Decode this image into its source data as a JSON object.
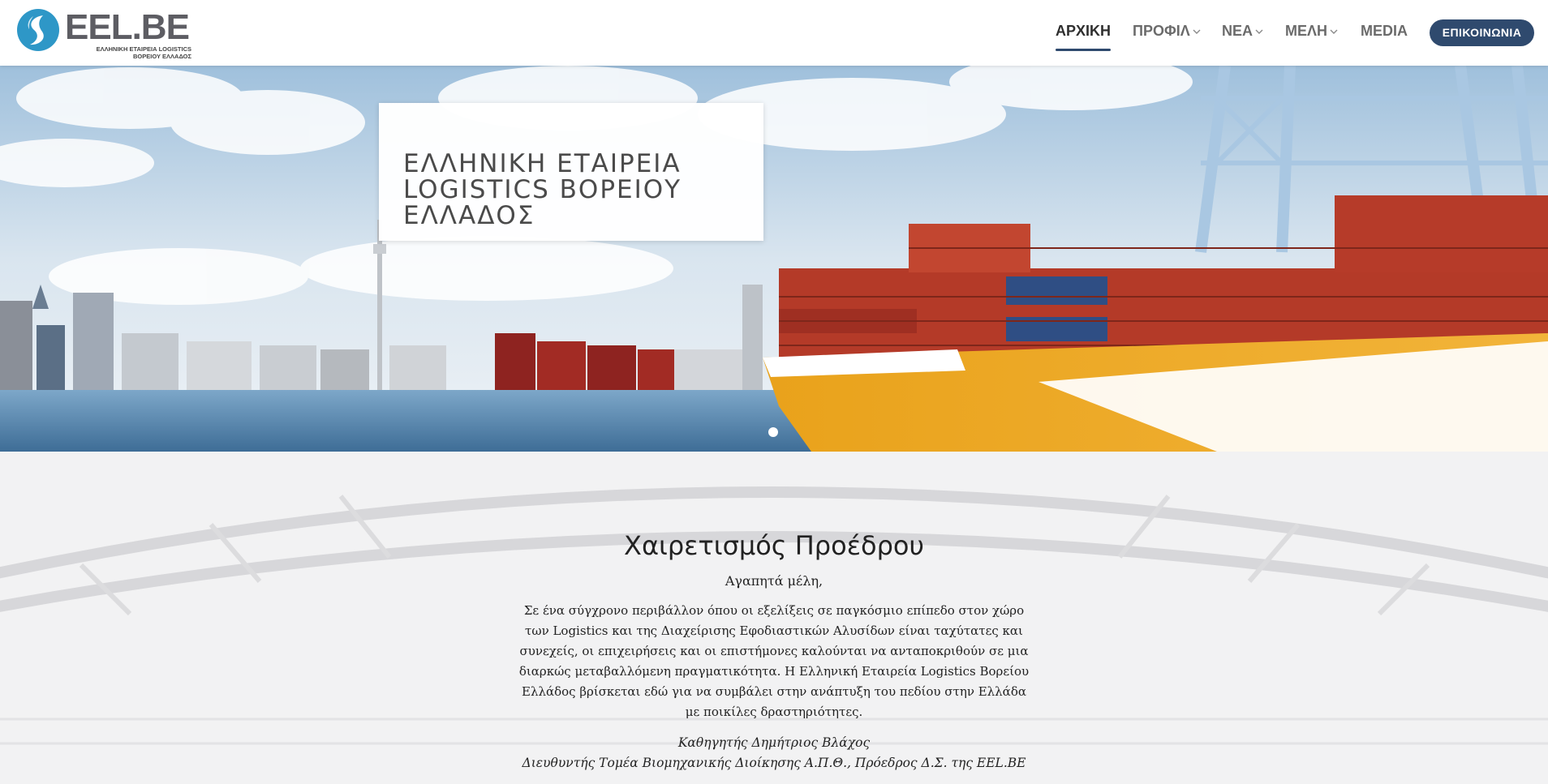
{
  "header": {
    "logo": {
      "wordmark": "EEL.BE",
      "subtitle_line1": "ΕΛΛΗΝΙΚΗ ΕΤΑΙΡΕΙΑ LOGISTICS",
      "subtitle_line2": "ΒΟΡΕΙΟΥ ΕΛΛΑΔΟΣ",
      "brand_color": "#2e97c7"
    },
    "nav": [
      {
        "label": "ΑΡΧΙΚΗ",
        "active": true
      },
      {
        "label": "ΠΡΟΦΙΛ",
        "dropdown": true
      },
      {
        "label": "ΝΕΑ",
        "dropdown": true
      },
      {
        "label": "ΜΕΛΗ",
        "dropdown": true
      },
      {
        "label": "MEDIA"
      }
    ],
    "cta_label": "ΕΠΙΚΟΙΝΩΝΙΑ",
    "accent_color": "#2f4a6e"
  },
  "hero": {
    "title": "ΕΛΛΗΝΙΚΗ ΕΤΑΙΡΕΙΑ LOGISTICS ΒΟΡΕΙΟΥ ΕΛΛΑΔΟΣ",
    "slides_count": 1,
    "active_slide": 1
  },
  "welcome": {
    "title": "Χαιρετισμός Προέδρου",
    "greeting": "Αγαπητά μέλη,",
    "body": "Σε ένα σύγχρονο περιβάλλον όπου οι εξελίξεις σε παγκόσμιο επίπεδο στον χώρο των Logistics και της Διαχείρισης Εφοδιαστικών Αλυσίδων είναι ταχύτατες και συνεχείς, οι επιχειρήσεις και οι επιστήμονες καλούνται να ανταποκριθούν σε μια διαρκώς μεταβαλλόμενη πραγματικότητα. Η Ελληνική Εταιρεία Logistics Βορείου Ελλάδος βρίσκεται εδώ για να συμβάλει στην ανάπτυξη του πεδίου στην Ελλάδα με ποικίλες δραστηριότητες.",
    "signature_name": "Καθηγητής Δημήτριος Βλάχος",
    "signature_title": "Διευθυντής Τομέα Βιομηχανικής Διοίκησης Α.Π.Θ., Πρόεδρος Δ.Σ. της EEL.BE"
  }
}
